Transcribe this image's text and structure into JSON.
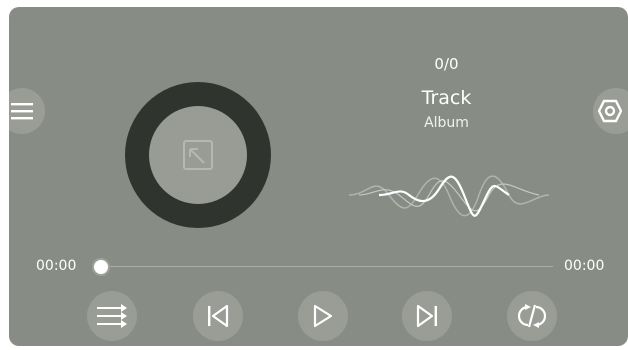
{
  "player": {
    "counter": "0/0",
    "track_title": "Track",
    "album_title": "Album",
    "current_time": "00:00",
    "total_time": "00:00",
    "progress": 0
  },
  "icons": {
    "menu": "menu-icon",
    "settings": "settings-icon",
    "album_art": "image-placeholder-icon",
    "playlist": "playlist-icon",
    "previous": "skip-previous-icon",
    "play": "play-icon",
    "next": "skip-next-icon",
    "shuffle": "shuffle-icon"
  },
  "colors": {
    "background": "#878c84",
    "disc_ring": "#30342f",
    "button": "#999d96",
    "text": "#ffffff"
  }
}
